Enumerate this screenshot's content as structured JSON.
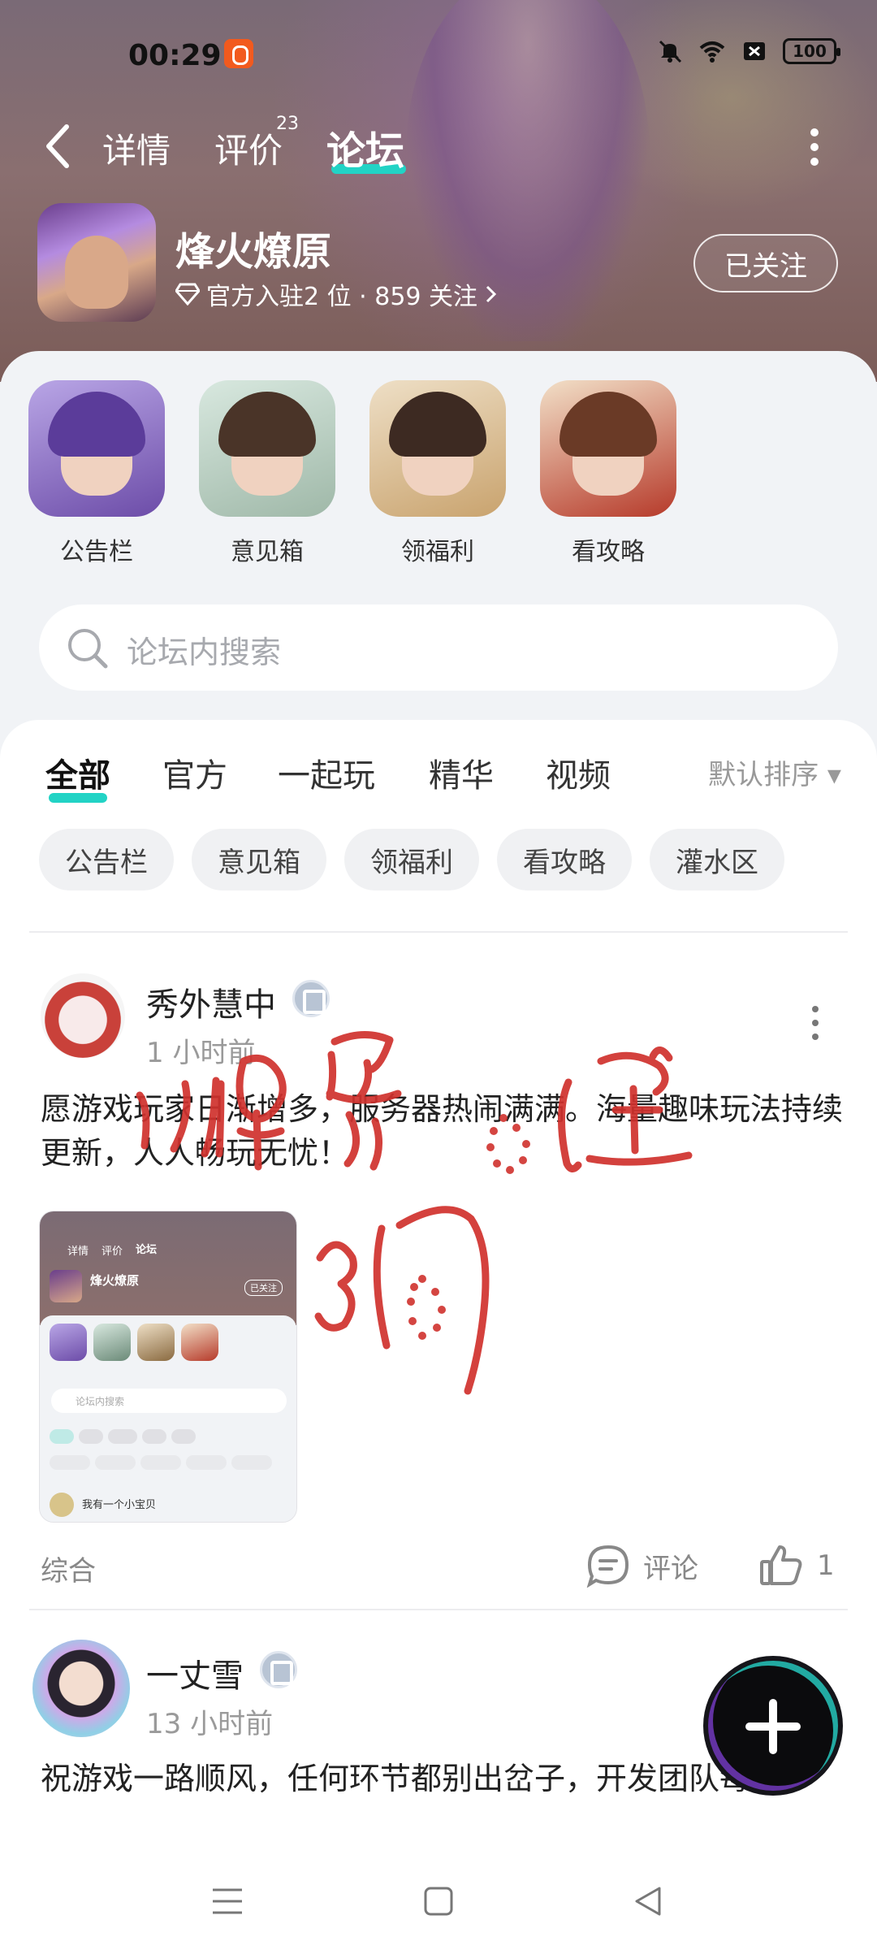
{
  "status_bar": {
    "time": "00:29",
    "battery": "100"
  },
  "nav": {
    "tabs": [
      {
        "label": "详情"
      },
      {
        "label": "评价",
        "badge": "23"
      },
      {
        "label": "论坛",
        "active": true
      }
    ]
  },
  "profile": {
    "name": "烽火燎原",
    "meta": "官方入驻2 位 · 859 关注",
    "follow_label": "已关注"
  },
  "shortcuts": [
    {
      "label": "公告栏"
    },
    {
      "label": "意见箱"
    },
    {
      "label": "领福利"
    },
    {
      "label": "看攻略"
    }
  ],
  "search": {
    "placeholder": "论坛内搜索"
  },
  "feed_tabs": [
    {
      "label": "全部",
      "active": true
    },
    {
      "label": "官方"
    },
    {
      "label": "一起玩"
    },
    {
      "label": "精华"
    },
    {
      "label": "视频"
    }
  ],
  "sort_label": "默认排序",
  "chips": [
    {
      "label": "公告栏"
    },
    {
      "label": "意见箱"
    },
    {
      "label": "领福利"
    },
    {
      "label": "看攻略"
    },
    {
      "label": "灌水区"
    }
  ],
  "posts": [
    {
      "user": "秀外慧中",
      "time": "1 小时前",
      "text": "愿游戏玩家日渐增多，服务器热闹满满。海量趣味玩法持续更新，人人畅玩无忧！",
      "category": "综合",
      "comment_label": "评论",
      "like_count": "1",
      "thumbnail": {
        "tabs": [
          "详情",
          "评价",
          "论坛"
        ],
        "name": "烽火燎原",
        "follow": "已关注",
        "search": "论坛内搜索",
        "first_post_user": "我有一个小宝贝"
      }
    },
    {
      "user": "一丈雪",
      "time": "13 小时前",
      "text": "祝游戏一路顺风，任何环节都别出岔子，开发团队每"
    }
  ],
  "colors": {
    "accent": "#22d3c5",
    "annotation": "#d0312d"
  }
}
